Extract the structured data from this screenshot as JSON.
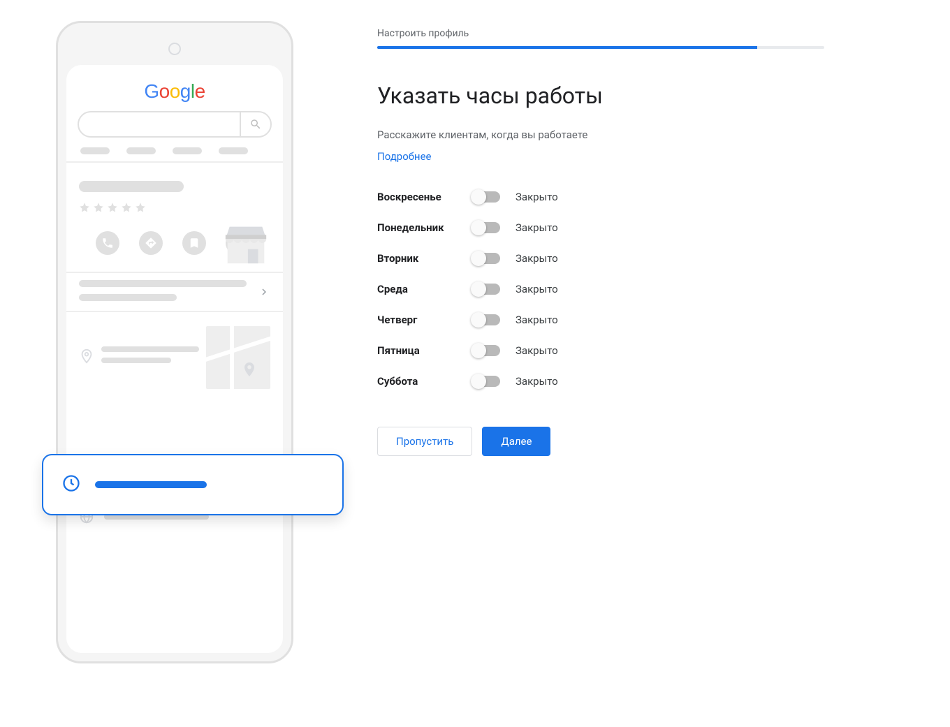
{
  "illustration": {
    "logo_text": "Google",
    "colors": {
      "accent": "#1a73e8"
    }
  },
  "header": {
    "step_label": "Настроить профиль",
    "progress_percent": 85
  },
  "main": {
    "title": "Указать часы работы",
    "subtitle": "Расскажите клиентам, когда вы работаете",
    "learn_more": "Подробнее"
  },
  "days": [
    {
      "name": "Воскресенье",
      "status": "Закрыто",
      "open": false
    },
    {
      "name": "Понедельник",
      "status": "Закрыто",
      "open": false
    },
    {
      "name": "Вторник",
      "status": "Закрыто",
      "open": false
    },
    {
      "name": "Среда",
      "status": "Закрыто",
      "open": false
    },
    {
      "name": "Четверг",
      "status": "Закрыто",
      "open": false
    },
    {
      "name": "Пятница",
      "status": "Закрыто",
      "open": false
    },
    {
      "name": "Суббота",
      "status": "Закрыто",
      "open": false
    }
  ],
  "buttons": {
    "skip": "Пропустить",
    "next": "Далее"
  }
}
